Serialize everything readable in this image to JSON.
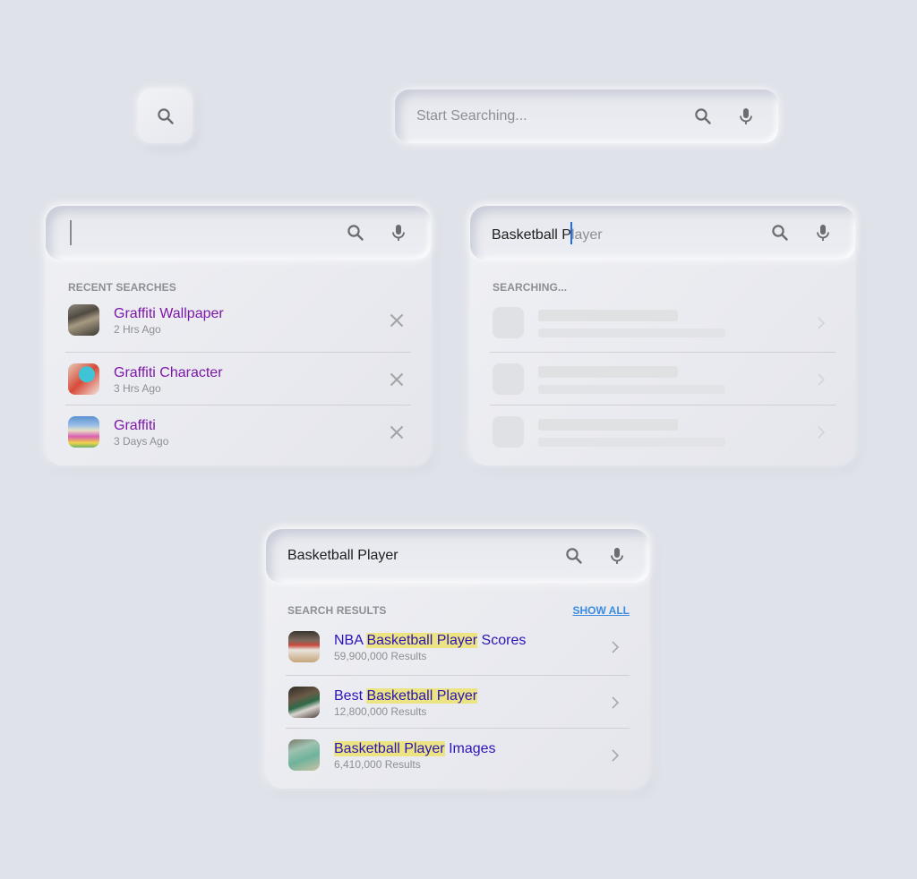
{
  "colors": {
    "background": "#dfe2e9",
    "recent_title": "#7c17a8",
    "result_title": "#2a14b8",
    "highlight": "#ece383",
    "caret": "#1f6fe8",
    "show_all": "#3b8ce0",
    "muted": "#8d8f95"
  },
  "icon_button": {
    "icon": "search-icon"
  },
  "standalone_bar": {
    "placeholder": "Start Searching...",
    "icons": [
      "search-icon",
      "microphone-icon"
    ]
  },
  "recent_card": {
    "input_value": "",
    "section_label": "RECENT SEARCHES",
    "items": [
      {
        "title": "Graffiti Wallpaper",
        "time": "2 Hrs Ago",
        "thumb": "graffiti-wallpaper-thumbnail",
        "action": "close-icon"
      },
      {
        "title": "Graffiti Character",
        "time": "3 Hrs Ago",
        "thumb": "graffiti-character-thumbnail",
        "action": "close-icon"
      },
      {
        "title": "Graffiti",
        "time": "3 Days Ago",
        "thumb": "graffiti-thumbnail",
        "action": "close-icon"
      }
    ]
  },
  "searching_card": {
    "typed_text": "Basketball P",
    "suggestion_text": "layer",
    "section_label": "SEARCHING...",
    "skeleton_rows": 3
  },
  "results_card": {
    "input_value": "Basketball Player",
    "section_label": "SEARCH RESULTS",
    "show_all_label": "SHOW ALL",
    "items": [
      {
        "prefix": "NBA ",
        "highlight": "Basketball Player",
        "suffix": " Scores",
        "count": "59,900,000 Results",
        "thumb": "nba-game-thumbnail"
      },
      {
        "prefix": "Best ",
        "highlight": "Basketball Player",
        "suffix": "",
        "count": "12,800,000 Results",
        "thumb": "basketball-players-thumbnail"
      },
      {
        "prefix": "",
        "highlight": "Basketball Player",
        "suffix": " Images",
        "count": "6,410,000 Results",
        "thumb": "basketball-court-thumbnail"
      }
    ]
  }
}
